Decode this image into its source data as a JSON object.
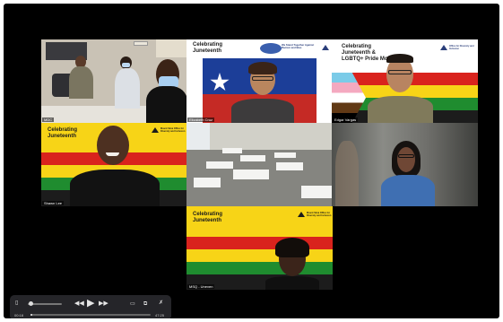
{
  "tiles": {
    "mdc": {
      "name": "MDC"
    },
    "elizabeth": {
      "name": "Elizabeth Cruz",
      "banner_title_1": "Celebrating",
      "banner_title_2": "Juneteenth",
      "banner_tagline": "We Stand Together Against Racism and Bias"
    },
    "edgar": {
      "name": "Edgar Vargas",
      "title_1": "Celebrating",
      "title_2": "Juneteenth &",
      "title_3": "LGBTQ+ Pride Month",
      "logo_text": "Office for Diversity and Inclusion"
    },
    "shawn": {
      "name": "Shawn Lee",
      "title_1": "Celebrating",
      "title_2": "Juneteenth",
      "logo_text": "Mount Sinai Office for Diversity and Inclusion"
    },
    "classroom": {
      "name": ""
    },
    "woman_glasses": {
      "name": ""
    },
    "msg": {
      "name": "MSQ - Uneven",
      "title_1": "Celebrating",
      "title_2": "Juneteenth",
      "logo_text": "Mount Sinai Office for Diversity and Inclusion"
    }
  },
  "player": {
    "time_elapsed": "00:18",
    "time_total": "47:25",
    "progress": 0.006,
    "volume_level": 0.05,
    "icons": {
      "volume": "volume-icon",
      "rewind": "rewind-icon",
      "play": "play-icon",
      "forward": "fast-forward-icon",
      "airplay": "airplay-icon",
      "pip": "picture-in-picture-icon",
      "close": "close-icon"
    }
  },
  "colors": {
    "juneteenth_yellow": "#f7d417",
    "juneteenth_red": "#d9231d",
    "juneteenth_green": "#1f8c2f"
  }
}
